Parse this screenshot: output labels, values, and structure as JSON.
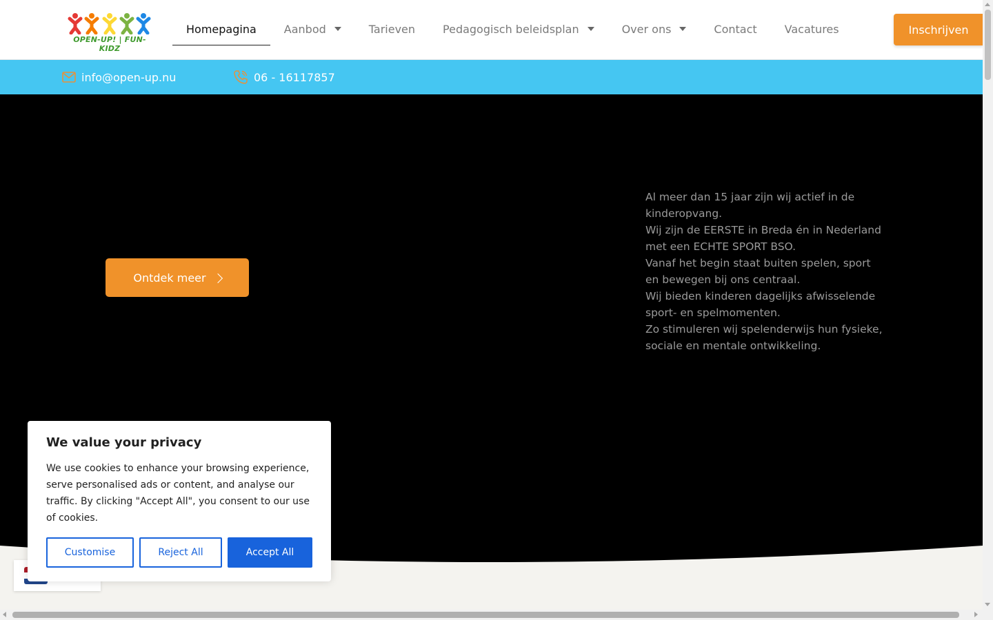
{
  "header": {
    "logo_text": "OPEN-UP! | FUN-KIDZ",
    "nav": [
      {
        "label": "Homepagina",
        "active": true,
        "dropdown": false
      },
      {
        "label": "Aanbod",
        "active": false,
        "dropdown": true
      },
      {
        "label": "Tarieven",
        "active": false,
        "dropdown": false
      },
      {
        "label": "Pedagogisch beleidsplan",
        "active": false,
        "dropdown": true
      },
      {
        "label": "Over ons",
        "active": false,
        "dropdown": true
      },
      {
        "label": "Contact",
        "active": false,
        "dropdown": false
      },
      {
        "label": "Vacatures",
        "active": false,
        "dropdown": false
      }
    ],
    "cta_label": "Inschrijven"
  },
  "infobar": {
    "email": "info@open-up.nu",
    "phone": "06 - 16117857"
  },
  "hero": {
    "button_label": "Ontdek meer",
    "text_lines": [
      "Al meer dan 15 jaar zijn wij actief in de kinderopvang.",
      "Wij zijn de EERSTE in Breda én in Nederland met een ECHTE SPORT BSO.",
      "Vanaf het begin staat buiten spelen, sport en bewegen bij ons centraal.",
      "Wij bieden kinderen dagelijks afwisselende sport- en spelmomenten.",
      "Zo stimuleren wij spelenderwijs hun fysieke, sociale en mentale ontwikkeling."
    ]
  },
  "cookie": {
    "title": "We value your privacy",
    "body": "We use cookies to enhance your browsing experience, serve personalised ads or content, and analyse our traffic. By clicking \"Accept All\", you consent to our use of cookies.",
    "customise_label": "Customise",
    "reject_label": "Reject All",
    "accept_label": "Accept All"
  },
  "colors": {
    "accent_orange": "#f0922a",
    "info_blue": "#45c6f2",
    "cookie_blue": "#1863dc"
  }
}
